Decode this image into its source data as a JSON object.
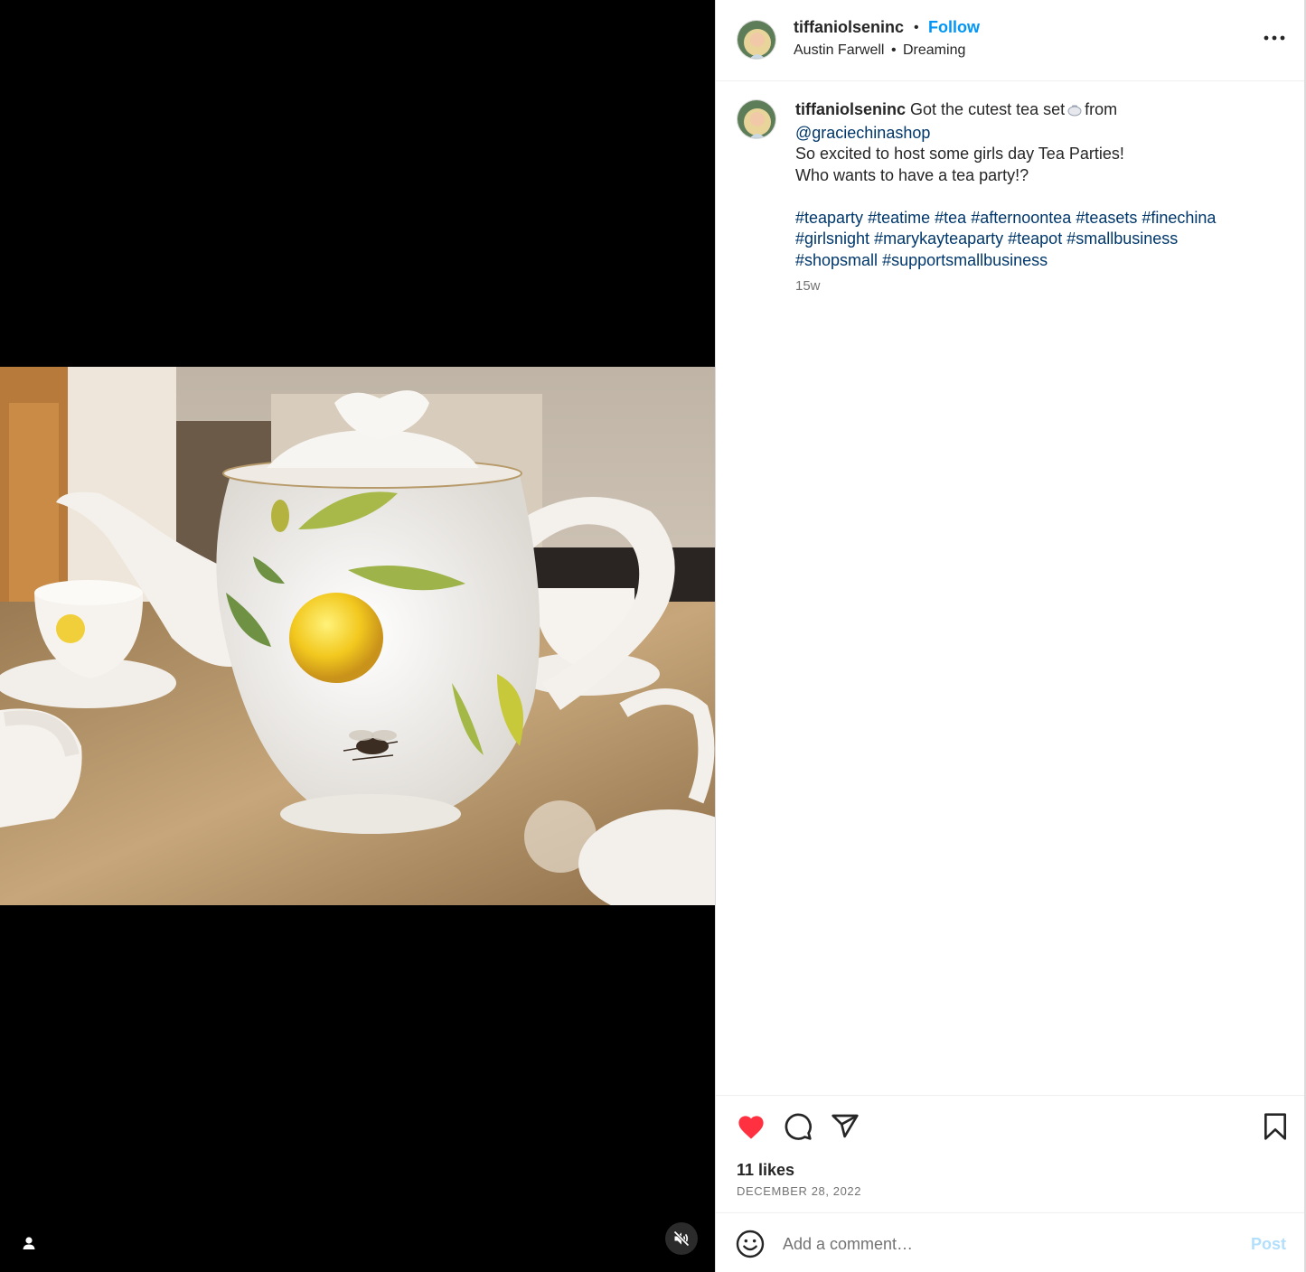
{
  "colors": {
    "accent": "#0095f6",
    "link": "#00376b",
    "like_red": "#ff3040",
    "muted": "#737373",
    "post_disabled": "#b2dffc"
  },
  "media": {
    "kind": "video",
    "description_icons": [
      "user-tag-icon",
      "muted-speaker-icon"
    ]
  },
  "header": {
    "username": "tiffaniolseninc",
    "separator": "•",
    "follow_label": "Follow",
    "audio_artist": "Austin Farwell",
    "audio_separator": "•",
    "audio_title": "Dreaming",
    "more_icon": "more-options-icon"
  },
  "caption": {
    "username": "tiffaniolseninc",
    "text_before_emoji": "Got the cutest tea set",
    "emoji": "teapot-emoji",
    "text_after_emoji": "from",
    "mention": "@graciechinashop",
    "line2": "So excited to host some girls day Tea Parties!",
    "line3": "Who wants to have a tea party!?",
    "hashtags_line1": [
      "#teaparty",
      "#teatime",
      "#tea",
      "#afternoontea",
      "#teasets",
      "#finechina"
    ],
    "hashtags_line2": [
      "#girlsnight",
      "#marykayteaparty",
      "#teapot",
      "#smallbusiness"
    ],
    "hashtags_line3": [
      "#shopsmall",
      "#supportsmallbusiness"
    ],
    "timestamp": "15w"
  },
  "actions": {
    "icons": [
      "heart-filled-icon",
      "comment-icon",
      "share-icon",
      "bookmark-icon"
    ],
    "likes": "11 likes",
    "date": "DECEMBER 28, 2022"
  },
  "comment": {
    "placeholder": "Add a comment…",
    "post_label": "Post"
  }
}
